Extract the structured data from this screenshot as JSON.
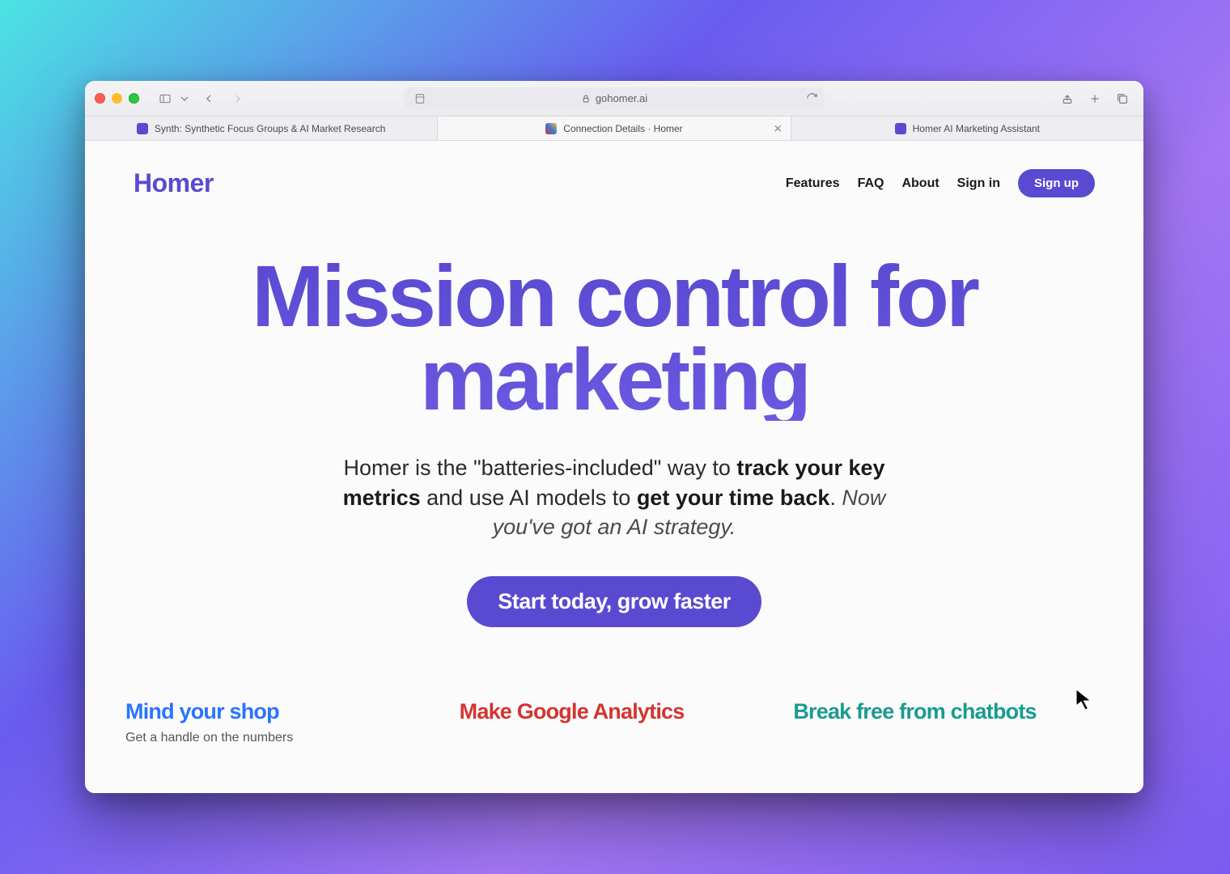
{
  "browser": {
    "url": "gohomer.ai",
    "tabs": [
      {
        "title": "Synth: Synthetic Focus Groups & AI Market Research",
        "favicon": "fav-purple",
        "active": false,
        "closable": false
      },
      {
        "title": "Connection Details · Homer",
        "favicon": "fav-multi",
        "active": true,
        "closable": true
      },
      {
        "title": "Homer AI Marketing Assistant",
        "favicon": "fav-purple",
        "active": false,
        "closable": false
      }
    ]
  },
  "site": {
    "logo": "Homer",
    "nav": {
      "features": "Features",
      "faq": "FAQ",
      "about": "About",
      "signin": "Sign in",
      "signup": "Sign up"
    },
    "hero": {
      "headline": "Mission control for marketing",
      "sub_pre": "Homer is the \"batteries-included\" way to ",
      "sub_bold1": "track your key metrics",
      "sub_mid": " and use AI models to ",
      "sub_bold2": "get your time back",
      "sub_period": ". ",
      "sub_italic": "Now you've got an AI strategy.",
      "cta": "Start today, grow faster"
    },
    "cards": [
      {
        "title": "Mind your shop",
        "body": "Get a handle on the numbers"
      },
      {
        "title": "Make Google Analytics",
        "body": ""
      },
      {
        "title": "Break free from chatbots",
        "body": ""
      }
    ]
  },
  "colors": {
    "brand": "#5a4ad1",
    "card_blue": "#2a74ff",
    "card_red": "#d4342f",
    "card_teal": "#1a9b8f"
  }
}
